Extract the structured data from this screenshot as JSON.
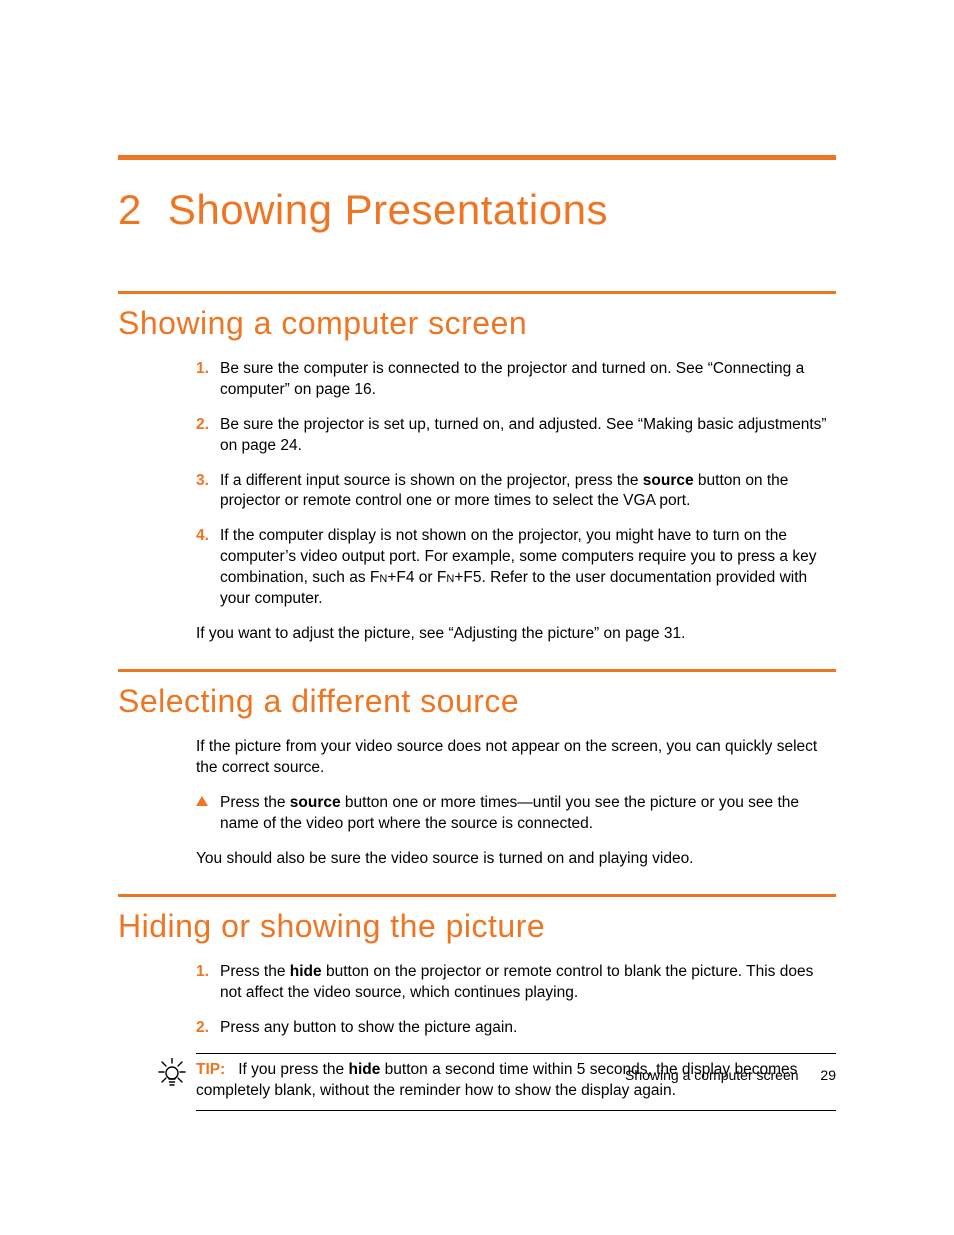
{
  "chapter": {
    "number": "2",
    "title": "Showing Presentations"
  },
  "sections": {
    "s1": {
      "title": "Showing a computer screen",
      "items": {
        "i1": {
          "num": "1.",
          "t1": "Be sure the computer is connected to the projector and turned on. See “Connecting a computer” on page 16."
        },
        "i2": {
          "num": "2.",
          "t1": "Be sure the projector is set up, turned on, and adjusted. See “Making basic adjustments” on page 24."
        },
        "i3": {
          "num": "3.",
          "before": "If a different input source is shown on the projector, press the ",
          "bold": "source",
          "after": " button on the projector or remote control one or more times to select the VGA port."
        },
        "i4": {
          "num": "4.",
          "before": "If the computer display is not shown on the projector, you might have to turn on the computer’s video output port. For example, some computers require you to press a key combination, such as ",
          "sc1": "Fn",
          "mid1": "+F4 or ",
          "sc2": "Fn",
          "after": "+F5. Refer to the user documentation provided with your computer."
        }
      },
      "tail": "If you want to adjust the picture, see “Adjusting the picture” on page 31."
    },
    "s2": {
      "title": "Selecting a different source",
      "lead": "If the picture from your video source does not appear on the screen, you can quickly select the correct source.",
      "bullet": {
        "before": "Press the ",
        "bold": "source",
        "after": " button one or more times—until you see the picture or you see the name of the video port where the source is connected."
      },
      "tail": "You should also be sure the video source is turned on and playing video."
    },
    "s3": {
      "title": "Hiding or showing the picture",
      "items": {
        "i1": {
          "num": "1.",
          "before": "Press the ",
          "bold": "hide",
          "after": " button on the projector or remote control to blank the picture. This does not affect the video source, which continues playing."
        },
        "i2": {
          "num": "2.",
          "t1": "Press any button to show the picture again."
        }
      }
    },
    "tip": {
      "label": "TIP:",
      "before": "If you press the ",
      "bold": "hide",
      "after": " button a second time within 5 seconds, the display becomes completely blank, without the reminder how to show the display again."
    }
  },
  "footer": {
    "section": "Showing a computer screen",
    "page": "29"
  }
}
